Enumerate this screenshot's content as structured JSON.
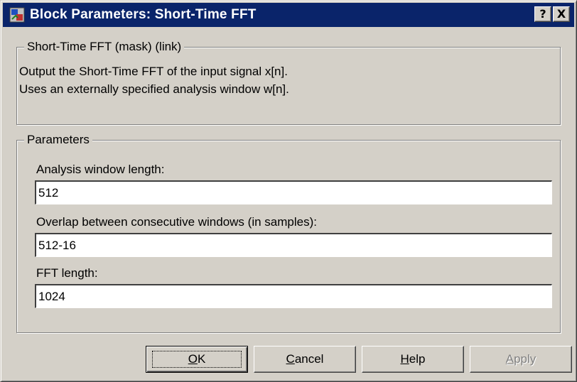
{
  "window": {
    "title": "Block Parameters: Short-Time FFT",
    "icon": "simulink-block-icon",
    "help_button": "?",
    "close_button": "X"
  },
  "description_group": {
    "legend": "Short-Time FFT (mask) (link)",
    "lines": [
      "Output the Short-Time FFT of the input signal x[n].",
      "Uses an externally specified analysis window w[n]."
    ]
  },
  "parameters_group": {
    "legend": "Parameters",
    "fields": [
      {
        "label": "Analysis window length:",
        "value": "512"
      },
      {
        "label": "Overlap between consecutive windows (in samples):",
        "value": "512-16"
      },
      {
        "label": "FFT length:",
        "value": "1024"
      }
    ]
  },
  "buttons": {
    "ok": {
      "label": "OK",
      "mnemonic": "O",
      "rest": "K"
    },
    "cancel": {
      "label": "Cancel",
      "mnemonic": "C",
      "rest": "ancel"
    },
    "help": {
      "label": "Help",
      "mnemonic": "H",
      "rest": "elp"
    },
    "apply": {
      "label": "Apply",
      "mnemonic": "A",
      "rest": "pply",
      "enabled": false
    }
  },
  "colors": {
    "titlebar": "#0a246a",
    "face": "#d4d0c8",
    "disabled_text": "#808080"
  }
}
